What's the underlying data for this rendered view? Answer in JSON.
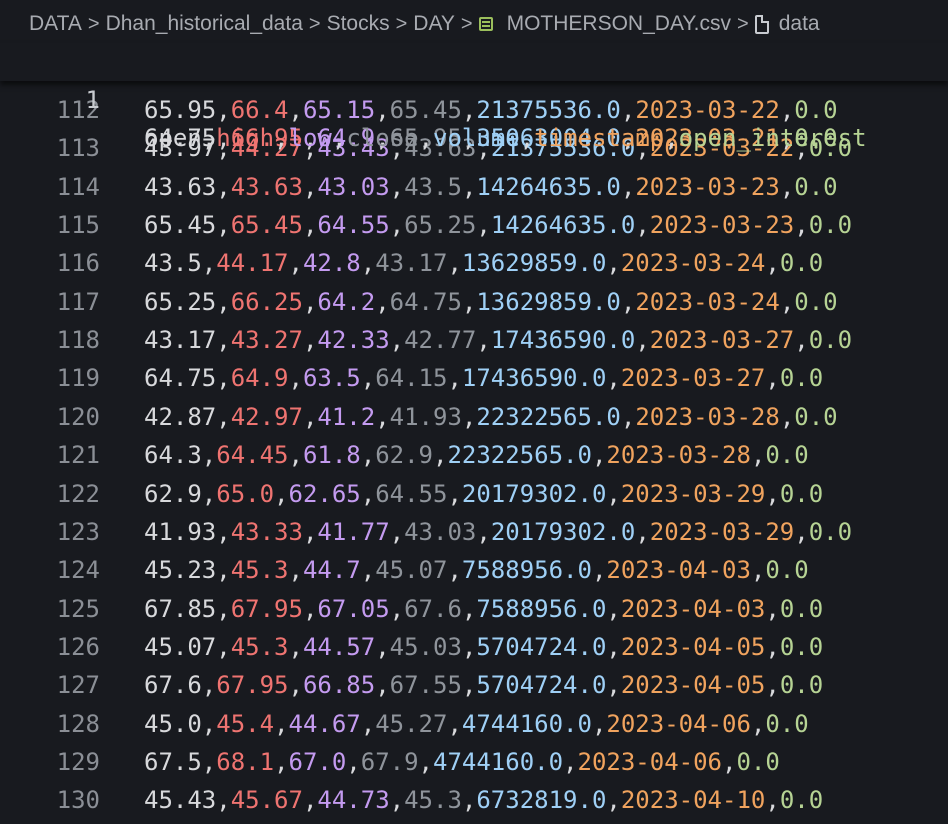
{
  "breadcrumb": {
    "items": [
      "DATA",
      "Dhan_historical_data",
      "Stocks",
      "DAY",
      "MOTHERSON_DAY.csv",
      "data"
    ],
    "separator": ">"
  },
  "icons": {
    "csv_file": "csv-table-icon",
    "symbol": "file-symbol-icon",
    "separator": "chevron-right-icon"
  },
  "colors": {
    "open": "#d8d9dc",
    "high": "#ef7471",
    "low": "#c49bf0",
    "close": "#8f949b",
    "volume": "#9fd0f6",
    "timestamp": "#f0a35e",
    "open_interest": "#b6d394"
  },
  "header": {
    "line_number": "1",
    "fields": [
      "open",
      "high",
      "low",
      "close",
      "volume",
      "timestamp",
      "open_interest"
    ]
  },
  "rows": [
    {
      "n": "112",
      "f": [
        "65.95",
        "66.4",
        "65.15",
        "65.45",
        "21375536.0",
        "2023-03-22",
        "0.0"
      ]
    },
    {
      "n": "113",
      "f": [
        "43.97",
        "44.27",
        "43.43",
        "43.63",
        "21375536.0",
        "2023-03-22",
        "0.0"
      ]
    },
    {
      "n": "114",
      "f": [
        "43.63",
        "43.63",
        "43.03",
        "43.5",
        "14264635.0",
        "2023-03-23",
        "0.0"
      ]
    },
    {
      "n": "115",
      "f": [
        "65.45",
        "65.45",
        "64.55",
        "65.25",
        "14264635.0",
        "2023-03-23",
        "0.0"
      ]
    },
    {
      "n": "116",
      "f": [
        "43.5",
        "44.17",
        "42.8",
        "43.17",
        "13629859.0",
        "2023-03-24",
        "0.0"
      ]
    },
    {
      "n": "117",
      "f": [
        "65.25",
        "66.25",
        "64.2",
        "64.75",
        "13629859.0",
        "2023-03-24",
        "0.0"
      ]
    },
    {
      "n": "118",
      "f": [
        "43.17",
        "43.27",
        "42.33",
        "42.77",
        "17436590.0",
        "2023-03-27",
        "0.0"
      ]
    },
    {
      "n": "119",
      "f": [
        "64.75",
        "64.9",
        "63.5",
        "64.15",
        "17436590.0",
        "2023-03-27",
        "0.0"
      ]
    },
    {
      "n": "120",
      "f": [
        "42.87",
        "42.97",
        "41.2",
        "41.93",
        "22322565.0",
        "2023-03-28",
        "0.0"
      ]
    },
    {
      "n": "121",
      "f": [
        "64.3",
        "64.45",
        "61.8",
        "62.9",
        "22322565.0",
        "2023-03-28",
        "0.0"
      ]
    },
    {
      "n": "122",
      "f": [
        "62.9",
        "65.0",
        "62.65",
        "64.55",
        "20179302.0",
        "2023-03-29",
        "0.0"
      ]
    },
    {
      "n": "123",
      "f": [
        "41.93",
        "43.33",
        "41.77",
        "43.03",
        "20179302.0",
        "2023-03-29",
        "0.0"
      ]
    },
    {
      "n": "124",
      "f": [
        "45.23",
        "45.3",
        "44.7",
        "45.07",
        "7588956.0",
        "2023-04-03",
        "0.0"
      ]
    },
    {
      "n": "125",
      "f": [
        "67.85",
        "67.95",
        "67.05",
        "67.6",
        "7588956.0",
        "2023-04-03",
        "0.0"
      ]
    },
    {
      "n": "126",
      "f": [
        "45.07",
        "45.3",
        "44.57",
        "45.03",
        "5704724.0",
        "2023-04-05",
        "0.0"
      ]
    },
    {
      "n": "127",
      "f": [
        "67.6",
        "67.95",
        "66.85",
        "67.55",
        "5704724.0",
        "2023-04-05",
        "0.0"
      ]
    },
    {
      "n": "128",
      "f": [
        "45.0",
        "45.4",
        "44.67",
        "45.27",
        "4744160.0",
        "2023-04-06",
        "0.0"
      ]
    },
    {
      "n": "129",
      "f": [
        "67.5",
        "68.1",
        "67.0",
        "67.9",
        "4744160.0",
        "2023-04-06",
        "0.0"
      ]
    },
    {
      "n": "130",
      "f": [
        "45.43",
        "45.67",
        "44.73",
        "45.3",
        "6732819.0",
        "2023-04-10",
        "0.0"
      ]
    }
  ]
}
